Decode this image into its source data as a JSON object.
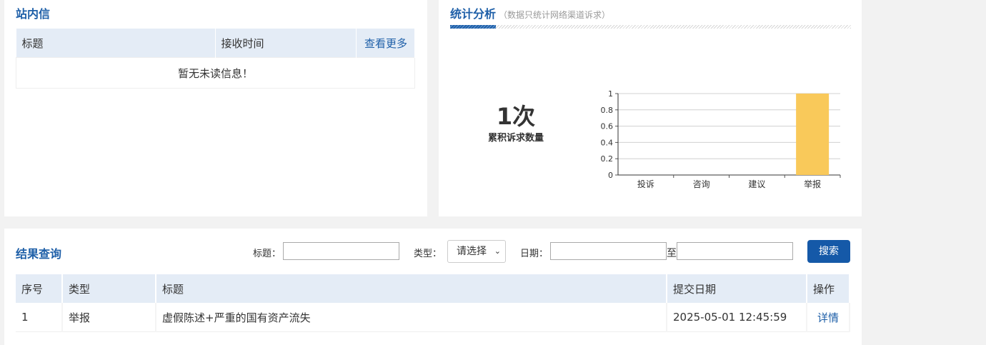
{
  "messages": {
    "title": "站内信",
    "col_title": "标题",
    "col_time": "接收时间",
    "more_link": "查看更多",
    "empty_text": "暂无未读信息！"
  },
  "stats": {
    "title": "统计分析",
    "subtitle": "（数据只统计网络渠道诉求）",
    "total_value": "1次",
    "total_label": "累积诉求数量"
  },
  "chart_data": {
    "type": "bar",
    "categories": [
      "投诉",
      "咨询",
      "建议",
      "举报"
    ],
    "values": [
      0,
      0,
      0,
      1
    ],
    "ylim": [
      0,
      1
    ],
    "yticks": [
      "0",
      "0.2",
      "0.4",
      "0.6",
      "0.8",
      "1"
    ],
    "grid": true,
    "bar_color": "#f9c95a"
  },
  "results": {
    "title": "结果查询",
    "filter_title_label": "标题：",
    "filter_title_value": "",
    "filter_type_label": "类型：",
    "filter_type_selected": "请选择",
    "filter_date_label": "日期：",
    "date_from": "",
    "date_sep": "至",
    "date_to": "",
    "search_button": "搜索",
    "columns": [
      "序号",
      "类型",
      "标题",
      "提交日期",
      "操作"
    ],
    "rows": [
      {
        "no": "1",
        "type": "举报",
        "title": "虚假陈述+严重的国有资产流失",
        "date": "2025-05-01 12:45:59",
        "action": "详情"
      }
    ]
  }
}
